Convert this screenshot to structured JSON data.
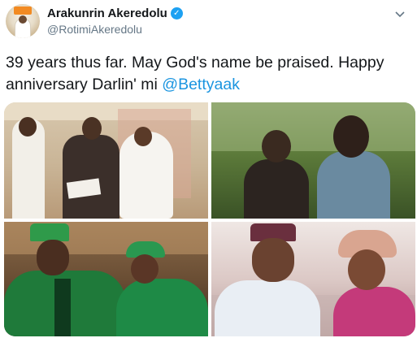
{
  "tweet": {
    "author": {
      "display_name": "Arakunrin Akeredolu",
      "handle": "@RotimiAkeredolu",
      "verified": true
    },
    "text_before_mention": "39 years thus far. May God's name be praised. Happy anniversary Darlin' mi ",
    "mention": "@Bettyaak",
    "menu_icon": "chevron-down-icon",
    "verified_icon": "verified-badge-icon"
  },
  "photos": [
    {
      "subject": "wedding-photo"
    },
    {
      "subject": "couple-outdoors-photo"
    },
    {
      "subject": "couple-green-attire-photo"
    },
    {
      "subject": "couple-portrait-photo"
    }
  ],
  "colors": {
    "link": "#1b95e0",
    "verified": "#1da1f2",
    "handle": "#657786",
    "text": "#14171a"
  }
}
